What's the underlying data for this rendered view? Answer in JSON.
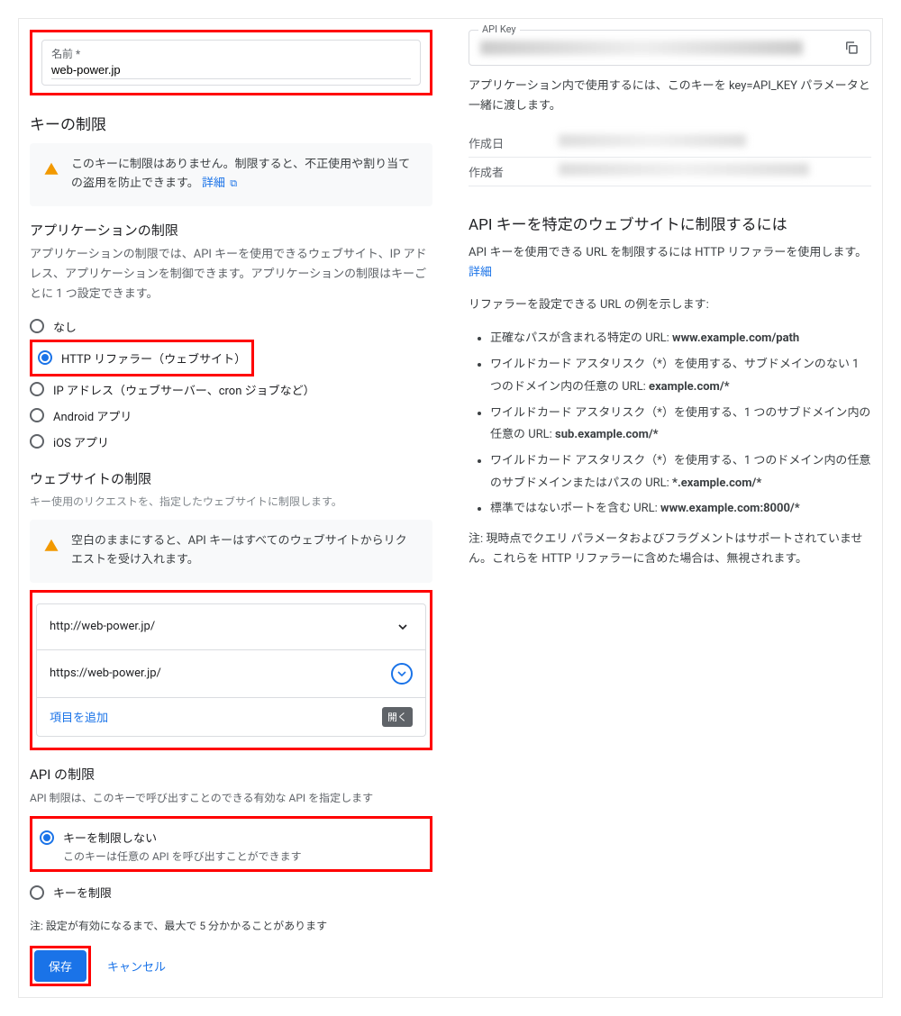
{
  "left": {
    "nameLabel": "名前 *",
    "nameValue": "web-power.jp",
    "keyRestrictTitle": "キーの制限",
    "keyRestrictWarn": "このキーに制限はありません。制限すると、不正使用や割り当ての盗用を防止できます。",
    "detailLink": "詳細",
    "appRestrictTitle": "アプリケーションの制限",
    "appRestrictDesc": "アプリケーションの制限では、API キーを使用できるウェブサイト、IP アドレス、アプリケーションを制御できます。アプリケーションの制限はキーごとに 1 つ設定できます。",
    "radios": {
      "none": "なし",
      "http": "HTTP リファラー（ウェブサイト）",
      "ip": "IP アドレス（ウェブサーバー、cron ジョブなど）",
      "android": "Android アプリ",
      "ios": "iOS アプリ"
    },
    "websiteTitle": "ウェブサイトの制限",
    "websiteDesc": "キー使用のリクエストを、指定したウェブサイトに制限します。",
    "websiteWarn": "空白のままにすると、API キーはすべてのウェブサイトからリクエストを受け入れます。",
    "urls": [
      "http://web-power.jp/",
      "https://web-power.jp/"
    ],
    "addItem": "項目を追加",
    "openLabel": "開く",
    "apiRestrictTitle": "API の制限",
    "apiRestrictDesc": "API 制限は、このキーで呼び出すことのできる有効な API を指定します",
    "apiRadios": {
      "unrestrict": "キーを制限しない",
      "unrestrictSub": "このキーは任意の API を呼び出すことができます",
      "restrict": "キーを制限"
    },
    "apiNote": "注: 設定が有効になるまで、最大で 5 分かかることがあります",
    "saveBtn": "保存",
    "cancelBtn": "キャンセル"
  },
  "right": {
    "apiKeyLabel": "API Key",
    "apiKeyDesc": "アプリケーション内で使用するには、このキーを key=API_KEY パラメータと一緒に渡します。",
    "createdLabel": "作成日",
    "creatorLabel": "作成者",
    "restrictTitle": "API キーを特定のウェブサイトに制限するには",
    "restrictDesc1": "API キーを使用できる URL を制限するには HTTP リファラーを使用します。",
    "detailLink": "詳細",
    "restrictDesc2": "リファラーを設定できる URL の例を示します:",
    "bullets": [
      {
        "pre": "正確なパスが含まれる特定の URL: ",
        "bold": "www.example.com/path"
      },
      {
        "pre": "ワイルドカード アスタリスク（*）を使用する、サブドメインのない 1 つのドメイン内の任意の URL: ",
        "bold": "example.com/*"
      },
      {
        "pre": "ワイルドカード アスタリスク（*）を使用する、1 つのサブドメイン内の任意の URL: ",
        "bold": "sub.example.com/*"
      },
      {
        "pre": "ワイルドカード アスタリスク（*）を使用する、1 つのドメイン内の任意のサブドメインまたはパスの URL: ",
        "bold": "*.example.com/*"
      },
      {
        "pre": "標準ではないポートを含む URL: ",
        "bold": "www.example.com:8000/*"
      }
    ],
    "note": "注: 現時点でクエリ パラメータおよびフラグメントはサポートされていません。これらを HTTP リファラーに含めた場合は、無視されます。"
  }
}
